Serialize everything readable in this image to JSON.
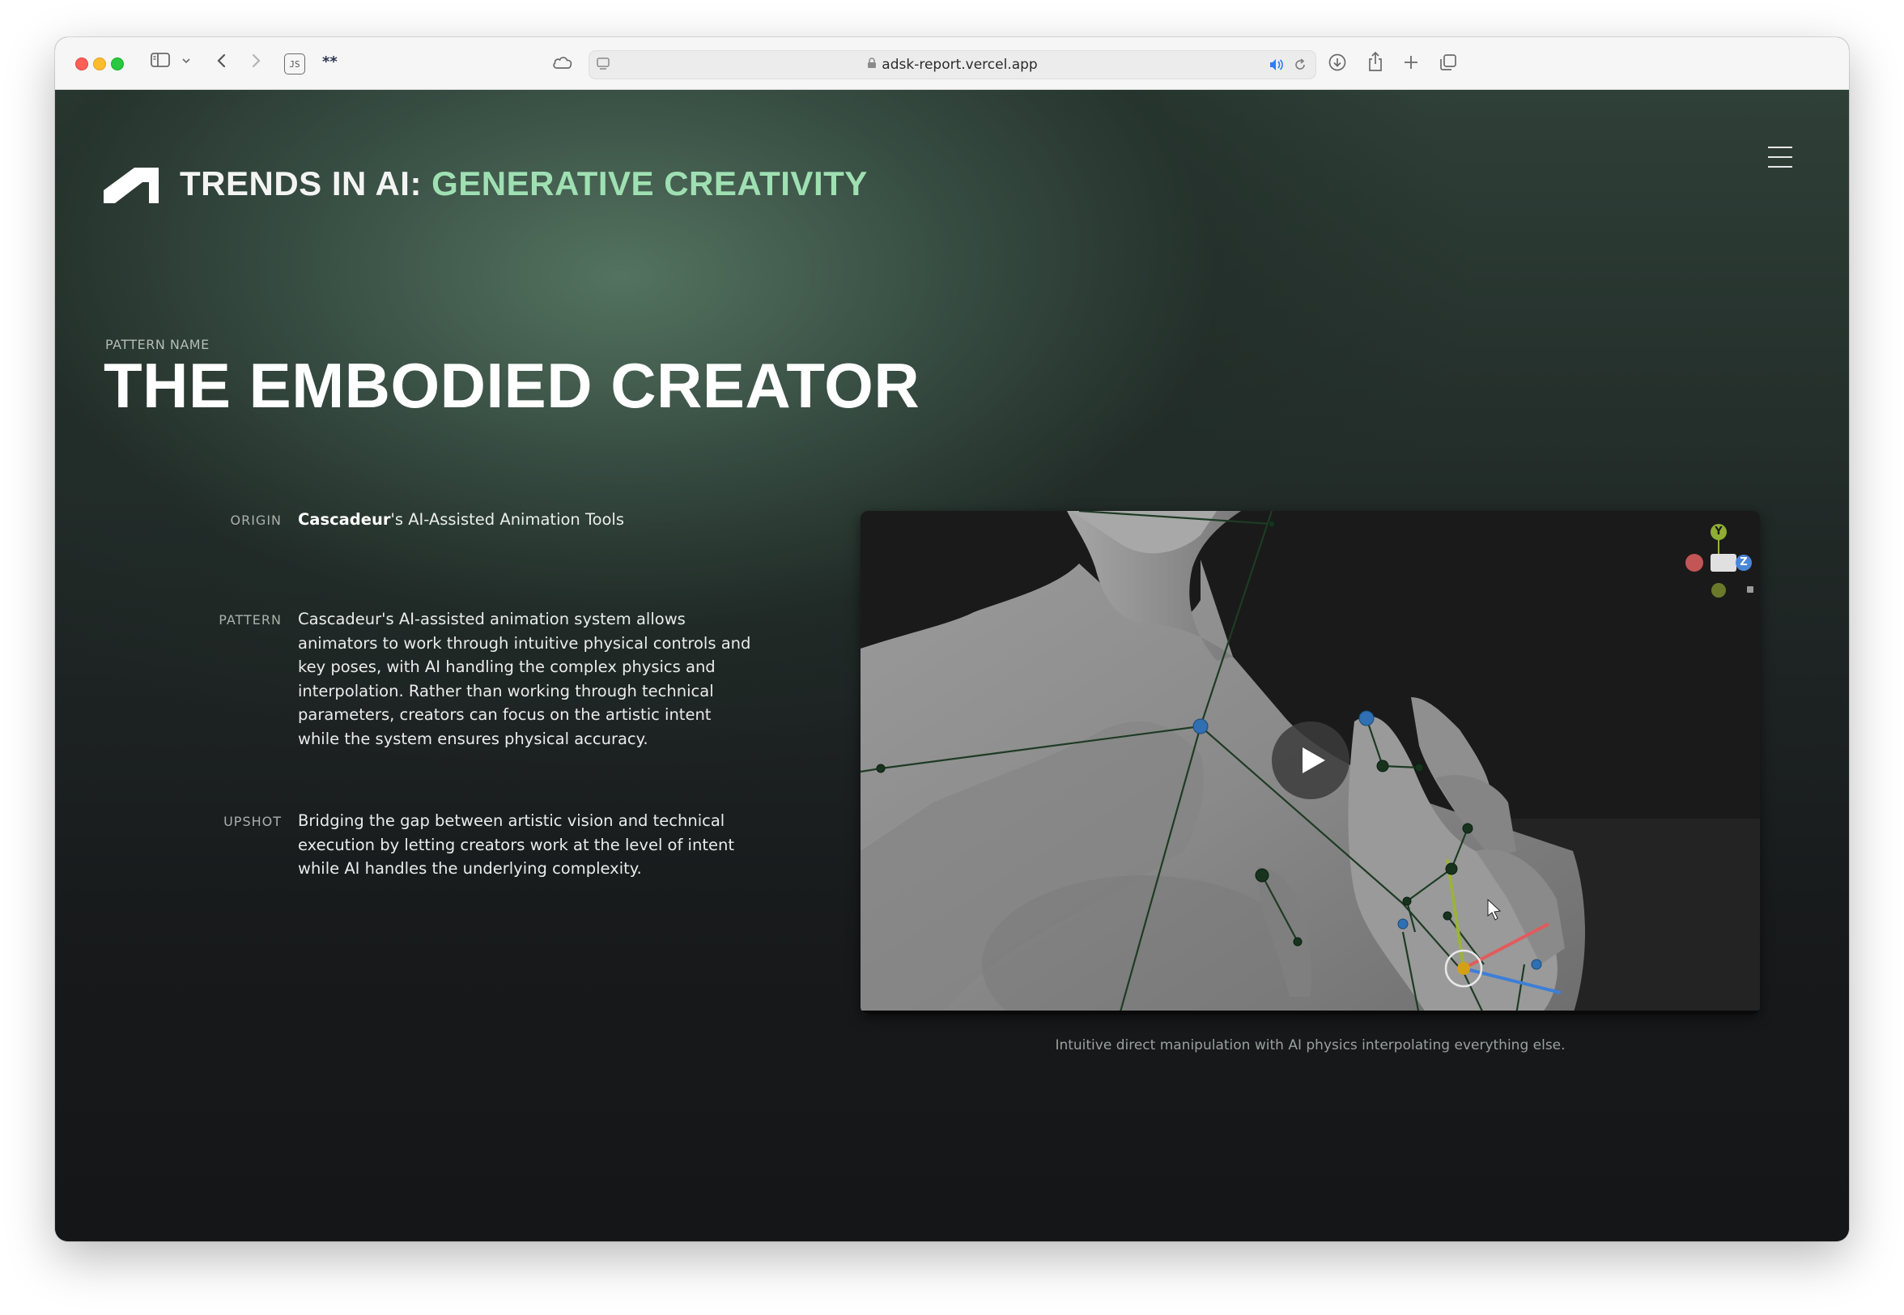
{
  "browser": {
    "url": "adsk-report.vercel.app",
    "icons": [
      "sidebar-icon",
      "chevron-down-icon",
      "back-icon",
      "forward-icon",
      "js-extension-icon",
      "extension-icon",
      "icloud-icon",
      "reader-icon",
      "lock-icon",
      "audio-icon",
      "reload-icon",
      "download-icon",
      "share-icon",
      "new-tab-icon",
      "tab-overview-icon"
    ],
    "js_badge": "JS",
    "ext_badge": "**"
  },
  "header": {
    "title_prefix": "TRENDS IN AI: ",
    "title_accent": "GENERATIVE CREATIVITY",
    "accent_color": "#9fe0b2"
  },
  "pattern": {
    "label": "PATTERN NAME",
    "name": "THE EMBODIED CREATOR"
  },
  "rows": {
    "origin": {
      "label": "ORIGIN",
      "strong": "Cascadeur",
      "rest": "'s AI-Assisted Animation Tools"
    },
    "pattern": {
      "label": "PATTERN",
      "text": "Cascadeur's AI-assisted animation system allows animators to work through intuitive physical controls and key poses, with AI handling the complex physics and interpolation. Rather than working through technical parameters, creators can focus on the artistic intent while the system ensures physical accuracy."
    },
    "upshot": {
      "label": "UPSHOT",
      "text": "Bridging the gap between artistic vision and technical execution by letting creators work at the level of intent while AI handles the underlying complexity."
    }
  },
  "video": {
    "gizmo_y": "Y",
    "gizmo_z": "Z",
    "caption": "Intuitive direct manipulation with AI physics interpolating everything else."
  }
}
